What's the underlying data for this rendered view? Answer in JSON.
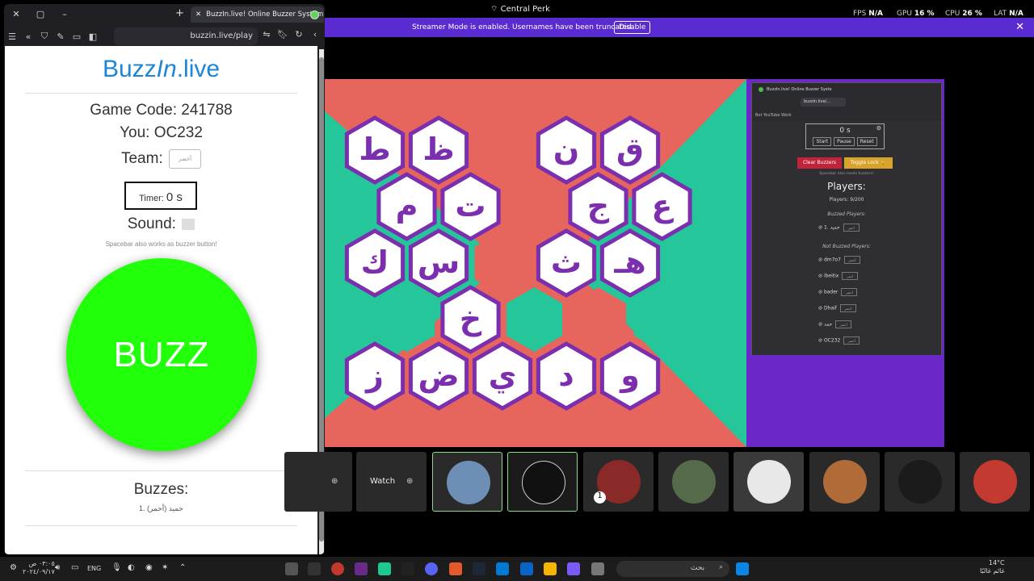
{
  "left_browser": {
    "tab_title": "BuzzIn.live! Online Buzzer System",
    "url": "buzzin.live/play",
    "page": {
      "logo_a": "Buzz",
      "logo_b": "In",
      "logo_c": ".live",
      "game_code": "Game Code: 241788",
      "you": "You: OC232",
      "team_label": "Team:",
      "team_value": "أخضر",
      "timer_label": "Timer:",
      "timer_value": "0 s",
      "sound_label": "Sound:",
      "spacebar_note": "Spacebar also works as buzzer button!",
      "buzz_label": "BUZZ",
      "buzzes_title": "Buzzes:",
      "buzzes_item": "1. حميد (أحمر)"
    }
  },
  "top_overlay": {
    "window_title": "Central Perk",
    "fps_label": "FPS",
    "fps_value": "N/A",
    "gpu_label": "GPU",
    "gpu_value": "16 %",
    "cpu_label": "CPU",
    "cpu_value": "26 %",
    "lat_label": "LAT",
    "lat_value": "N/A",
    "streamer_msg": "Streamer Mode is enabled. Usernames have been truncated.",
    "disable_label": "Disable"
  },
  "board": {
    "colors": {
      "red": "#e6655d",
      "green": "#25c79a",
      "purple": "#7b2fae",
      "white": "#ffffff"
    },
    "rows": [
      [
        {
          "letter": "ط",
          "fill": "white"
        },
        {
          "letter": "ظ",
          "fill": "white"
        },
        {
          "letter": "",
          "fill": "red"
        },
        {
          "letter": "ن",
          "fill": "white"
        },
        {
          "letter": "ق",
          "fill": "white"
        }
      ],
      [
        {
          "letter": "م",
          "fill": "white"
        },
        {
          "letter": "ت",
          "fill": "white"
        },
        {
          "letter": "",
          "fill": "red"
        },
        {
          "letter": "ج",
          "fill": "white"
        },
        {
          "letter": "ع",
          "fill": "white"
        }
      ],
      [
        {
          "letter": "ك",
          "fill": "white"
        },
        {
          "letter": "س",
          "fill": "white"
        },
        {
          "letter": "",
          "fill": "red"
        },
        {
          "letter": "ث",
          "fill": "white"
        },
        {
          "letter": "هـ",
          "fill": "white"
        }
      ],
      [
        {
          "letter": "",
          "fill": "green"
        },
        {
          "letter": "خ",
          "fill": "white"
        },
        {
          "letter": "",
          "fill": "green"
        },
        {
          "letter": "",
          "fill": "red"
        },
        {
          "letter": "",
          "fill": "green"
        }
      ],
      [
        {
          "letter": "ز",
          "fill": "white"
        },
        {
          "letter": "ض",
          "fill": "white"
        },
        {
          "letter": "ي",
          "fill": "white"
        },
        {
          "letter": "د",
          "fill": "white"
        },
        {
          "letter": "و",
          "fill": "white"
        }
      ]
    ]
  },
  "mini_browser": {
    "tab_title": "BuzzIn.live! Online Buzzer Syste",
    "url": "buzzin.live/...",
    "bookmarks": "Bot   YouTube   Work",
    "timer_value": "0 s",
    "start": "Start",
    "pause": "Pause",
    "reset": "Reset",
    "clear_buzzers": "Clear Buzzers",
    "toggle_lock": "Toggle Lock 🔓",
    "note": "Spacebar also resets buzzers!",
    "players_title": "Players:",
    "players_count": "Players: 9/200",
    "buzzed_title": "Buzzed Players:",
    "buzzed": [
      {
        "name": "1. حميد",
        "team": "أحمر"
      }
    ],
    "not_buzzed_title": "Not Buzzed Players:",
    "not_buzzed": [
      {
        "name": "dm7o7",
        "team": "أخضر"
      },
      {
        "name": "ibeitix",
        "team": "أحمر"
      },
      {
        "name": "bader",
        "team": "أخضر"
      },
      {
        "name": "Dhaif",
        "team": "أخضر"
      },
      {
        "name": "حمد",
        "team": "أخضر"
      },
      {
        "name": "OC232",
        "team": "أخضر"
      }
    ]
  },
  "strip": {
    "watch_label": "Watch",
    "badge": "1"
  },
  "taskbar": {
    "time": "٠٣:٠٥ ص",
    "date": "٢٠٢٤/٠٩/١٧",
    "lang": "ENG",
    "search_placeholder": "بحث",
    "temp": "14°C",
    "weather_text": "غائم غالبًا"
  }
}
